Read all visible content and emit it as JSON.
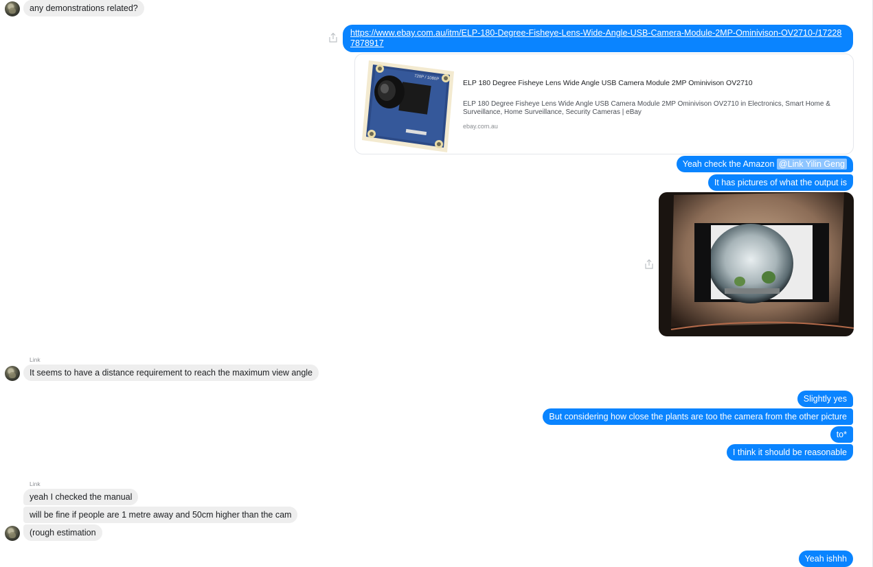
{
  "conversation": {
    "incoming_top": {
      "text": "any demonstrations related?"
    },
    "outgoing_link": {
      "url_text": "https://www.ebay.com.au/itm/ELP-180-Degree-Fisheye-Lens-Wide-Angle-USB-Camera-Module-2MP-Ominivison-OV2710-/172287878917"
    },
    "link_preview": {
      "title": "ELP 180 Degree Fisheye Lens Wide Angle USB Camera Module 2MP Ominivison OV2710",
      "description": "ELP 180 Degree Fisheye Lens Wide Angle USB Camera Module 2MP Ominivison OV2710 in Electronics, Smart Home & Surveillance, Home Surveillance, Security Cameras | eBay",
      "domain": "ebay.com.au",
      "thumb_label": "720P / 1080P"
    },
    "outgoing_amazon": {
      "text": "Yeah check the Amazon ",
      "mention": "@Link Yilin Geng"
    },
    "outgoing_pictures": {
      "text": "It has pictures of what the output is"
    },
    "incoming_group_1": {
      "sender": "Link",
      "messages": [
        "It seems to have a distance requirement to reach the maximum view angle"
      ]
    },
    "outgoing_group_2": {
      "messages": [
        "Slightly yes",
        "But considering how close the plants are too the camera from the other picture",
        "to*",
        "I think it should be reasonable"
      ]
    },
    "incoming_group_2": {
      "sender": "Link",
      "messages": [
        "yeah I checked the manual",
        "will be fine if people are 1 metre away and 50cm higher than the cam",
        "(rough estimation"
      ]
    },
    "outgoing_last": {
      "text": "Yeah ishhh"
    }
  },
  "colors": {
    "outgoing_bubble": "#0a84ff",
    "incoming_bubble": "#eeeeee",
    "mention_highlight": "#8ec5ff"
  }
}
